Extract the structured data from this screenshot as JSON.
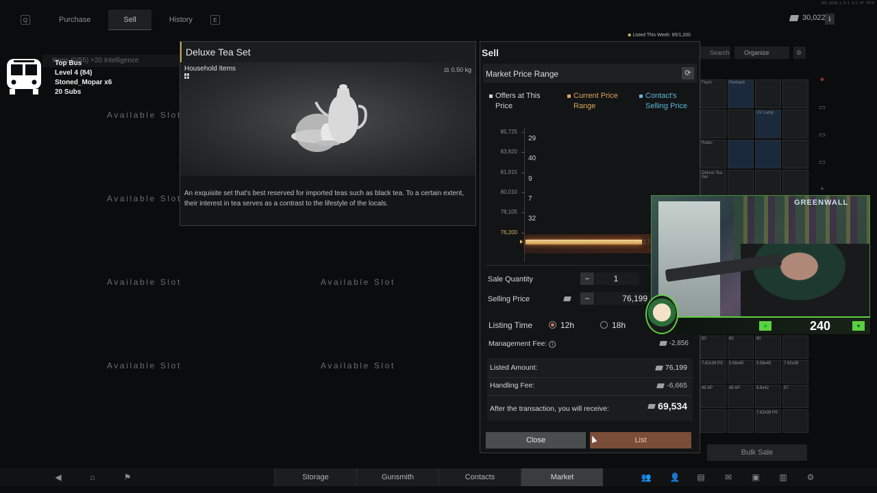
{
  "nav": {
    "left_key": "Q",
    "tabs": [
      {
        "label": "Purchase"
      },
      {
        "label": "Sell"
      },
      {
        "label": "History"
      }
    ],
    "right_key": "E",
    "active_tab": "Sell"
  },
  "header": {
    "currency_amount": "30,022K",
    "info_icon": "info-icon"
  },
  "streamer": {
    "lines": [
      "Top Bus",
      "Level 4  (84)",
      "Stoned_Mopar x6",
      "20 Subs"
    ],
    "behind_text": "Items (0/55)  +20  Intelligence"
  },
  "slots": {
    "label": "Available Slot"
  },
  "item": {
    "title": "Deluxe Tea Set",
    "category": "Household Items",
    "weight": "0.50 kg",
    "description": "An exquisite set that's best reserved for imported teas such as black tea. To a certain extent, their interest in tea serves as a contrast to the lifestyle of the locals."
  },
  "sell": {
    "listed_this_week": "Listed This Week: 85/1,200",
    "title": "Sell",
    "market_price_range": "Market Price Range",
    "legend": [
      {
        "label": "Offers at This Price",
        "color": "#d0d3d5"
      },
      {
        "label": "Current Price Range",
        "color": "#d9a75a"
      },
      {
        "label": "Contact's Selling Price",
        "color": "#5ab8d8"
      }
    ],
    "sale_quantity_label": "Sale Quantity",
    "sale_quantity": "1",
    "selling_price_label": "Selling Price",
    "selling_price": "76,199",
    "listing_time_label": "Listing Time",
    "listing_options": [
      "12h",
      "18h"
    ],
    "selected_listing": "12h",
    "management_fee_label": "Management Fee:",
    "management_fee": "-2,856",
    "listed_amount_label": "Listed Amount:",
    "listed_amount": "76,199",
    "handling_fee_label": "Handling Fee:",
    "handling_fee": "-6,665",
    "receive_label": "After the transaction, you will receive:",
    "receive_amount": "69,534",
    "close_label": "Close",
    "list_label": "List"
  },
  "chart_data": {
    "type": "bar",
    "title": "Market Price Range",
    "orientation": "horizontal",
    "categories": [
      "85,725",
      "83,820",
      "81,915",
      "80,010",
      "78,105",
      "76,200"
    ],
    "values": [
      29,
      40,
      9,
      7,
      32,
      17
    ],
    "current_price_category": "76,200",
    "current_bar_label": "17"
  },
  "inventory": {
    "search_label": "Search",
    "organize_label": "Organize",
    "top_items": [
      "Flash",
      "Pwrbank",
      "",
      "",
      "",
      "",
      "UV Lamp",
      "",
      "Radio",
      "",
      "",
      "",
      "Deluxe Tea Set",
      "",
      "",
      ""
    ],
    "ammo_items": [
      "50",
      "60",
      "60",
      "",
      "7.62x39 PS",
      "5.56x45",
      "5.56x45",
      "7.62x39",
      "45 AP",
      "45 AP",
      "5.8x42",
      "57",
      "",
      "",
      "7.62x39 PS",
      ""
    ],
    "bulk_sale_label": "Bulk Sale"
  },
  "webcam": {
    "sign_text": "GREENWALL",
    "hud_value": "240"
  },
  "bottom": {
    "tabs": [
      "Storage",
      "Gunsmith",
      "Contacts",
      "Market"
    ],
    "active_tab": "Market"
  }
}
